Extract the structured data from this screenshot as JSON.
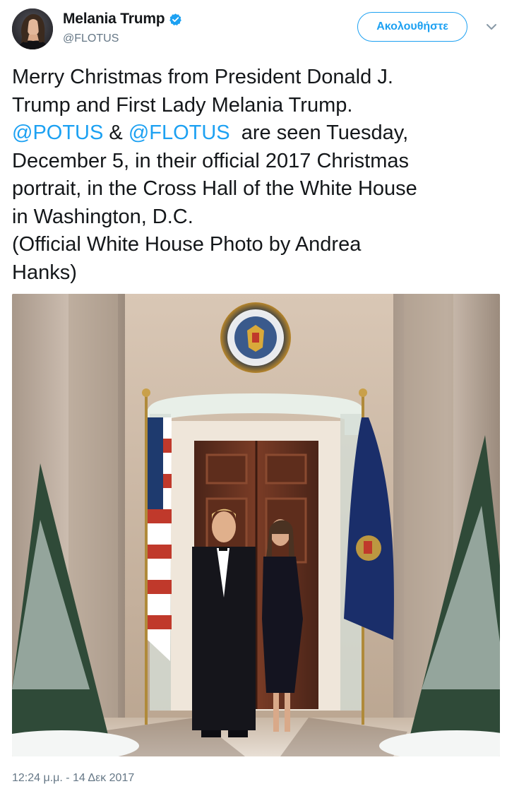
{
  "header": {
    "display_name": "Melania Trump",
    "handle": "@FLOTUS",
    "follow_label": "Ακολουθήστε",
    "verified_icon": "verified-badge-icon",
    "more_icon": "chevron-down-icon"
  },
  "tweet": {
    "text_parts": [
      "Merry Christmas from President Donald J.\nTrump and First Lady Melania Trump.\n",
      "@POTUS",
      " & ",
      "@FLOTUS",
      "  are seen Tuesday,\nDecember 5, in their official 2017 Christmas\nportrait, in the Cross Hall of the White House\nin Washington, D.C.\n(Official White House Photo by Andrea\nHanks)"
    ],
    "timestamp": "12:24 μ.μ. - 14 Δεκ 2017"
  },
  "colors": {
    "accent": "#1da1f2",
    "text": "#14171a",
    "secondary": "#657786"
  }
}
